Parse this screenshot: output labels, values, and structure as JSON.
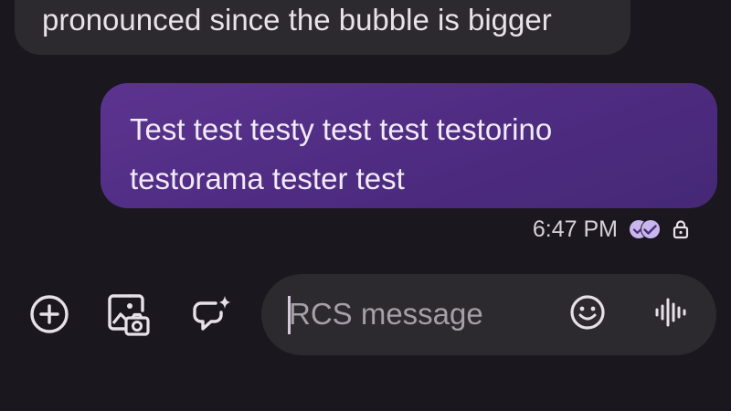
{
  "conversation": {
    "incoming_message": {
      "text": "pronounced since the bubble is bigger"
    },
    "outgoing_message": {
      "lines": [
        "Test test testy test test testorino",
        "testorama tester test"
      ],
      "time": "6:47 PM",
      "status_icons": [
        "read-receipt-icon",
        "lock-icon"
      ]
    }
  },
  "composer": {
    "placeholder": "RCS message",
    "value": "",
    "buttons": [
      "add-icon",
      "gallery-camera-icon",
      "ai-compose-icon",
      "emoji-icon",
      "voice-message-icon"
    ]
  },
  "colors": {
    "background": "#1b171e",
    "incoming_bubble": "#2c292f",
    "outgoing_bubble": "#55308a",
    "read_receipt": "#c9b6ef",
    "icon": "#e6e0e9"
  }
}
